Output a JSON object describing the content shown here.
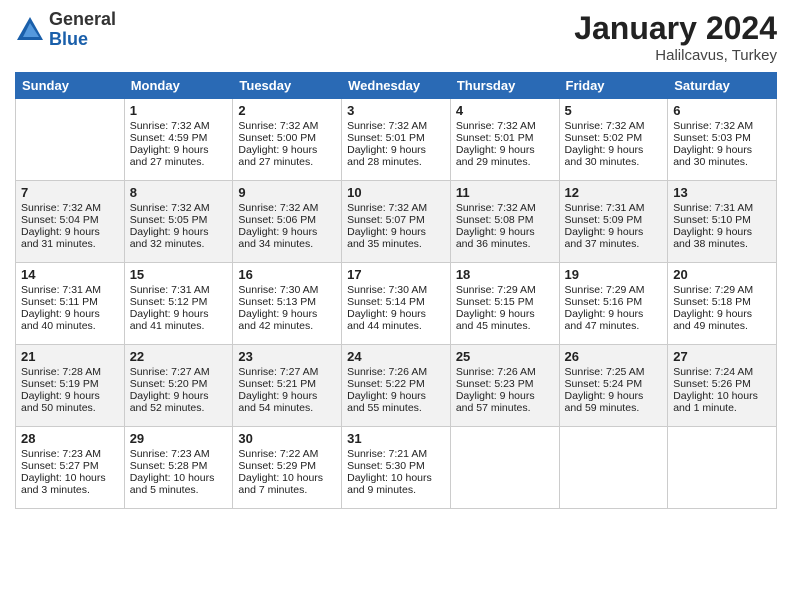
{
  "logo": {
    "general": "General",
    "blue": "Blue"
  },
  "title": {
    "month_year": "January 2024",
    "location": "Halilcavus, Turkey"
  },
  "days_of_week": [
    "Sunday",
    "Monday",
    "Tuesday",
    "Wednesday",
    "Thursday",
    "Friday",
    "Saturday"
  ],
  "weeks": [
    [
      {
        "day": "",
        "sunrise": "",
        "sunset": "",
        "daylight": ""
      },
      {
        "day": "1",
        "sunrise": "Sunrise: 7:32 AM",
        "sunset": "Sunset: 4:59 PM",
        "daylight": "Daylight: 9 hours and 27 minutes."
      },
      {
        "day": "2",
        "sunrise": "Sunrise: 7:32 AM",
        "sunset": "Sunset: 5:00 PM",
        "daylight": "Daylight: 9 hours and 27 minutes."
      },
      {
        "day": "3",
        "sunrise": "Sunrise: 7:32 AM",
        "sunset": "Sunset: 5:01 PM",
        "daylight": "Daylight: 9 hours and 28 minutes."
      },
      {
        "day": "4",
        "sunrise": "Sunrise: 7:32 AM",
        "sunset": "Sunset: 5:01 PM",
        "daylight": "Daylight: 9 hours and 29 minutes."
      },
      {
        "day": "5",
        "sunrise": "Sunrise: 7:32 AM",
        "sunset": "Sunset: 5:02 PM",
        "daylight": "Daylight: 9 hours and 30 minutes."
      },
      {
        "day": "6",
        "sunrise": "Sunrise: 7:32 AM",
        "sunset": "Sunset: 5:03 PM",
        "daylight": "Daylight: 9 hours and 30 minutes."
      }
    ],
    [
      {
        "day": "7",
        "sunrise": "Sunrise: 7:32 AM",
        "sunset": "Sunset: 5:04 PM",
        "daylight": "Daylight: 9 hours and 31 minutes."
      },
      {
        "day": "8",
        "sunrise": "Sunrise: 7:32 AM",
        "sunset": "Sunset: 5:05 PM",
        "daylight": "Daylight: 9 hours and 32 minutes."
      },
      {
        "day": "9",
        "sunrise": "Sunrise: 7:32 AM",
        "sunset": "Sunset: 5:06 PM",
        "daylight": "Daylight: 9 hours and 34 minutes."
      },
      {
        "day": "10",
        "sunrise": "Sunrise: 7:32 AM",
        "sunset": "Sunset: 5:07 PM",
        "daylight": "Daylight: 9 hours and 35 minutes."
      },
      {
        "day": "11",
        "sunrise": "Sunrise: 7:32 AM",
        "sunset": "Sunset: 5:08 PM",
        "daylight": "Daylight: 9 hours and 36 minutes."
      },
      {
        "day": "12",
        "sunrise": "Sunrise: 7:31 AM",
        "sunset": "Sunset: 5:09 PM",
        "daylight": "Daylight: 9 hours and 37 minutes."
      },
      {
        "day": "13",
        "sunrise": "Sunrise: 7:31 AM",
        "sunset": "Sunset: 5:10 PM",
        "daylight": "Daylight: 9 hours and 38 minutes."
      }
    ],
    [
      {
        "day": "14",
        "sunrise": "Sunrise: 7:31 AM",
        "sunset": "Sunset: 5:11 PM",
        "daylight": "Daylight: 9 hours and 40 minutes."
      },
      {
        "day": "15",
        "sunrise": "Sunrise: 7:31 AM",
        "sunset": "Sunset: 5:12 PM",
        "daylight": "Daylight: 9 hours and 41 minutes."
      },
      {
        "day": "16",
        "sunrise": "Sunrise: 7:30 AM",
        "sunset": "Sunset: 5:13 PM",
        "daylight": "Daylight: 9 hours and 42 minutes."
      },
      {
        "day": "17",
        "sunrise": "Sunrise: 7:30 AM",
        "sunset": "Sunset: 5:14 PM",
        "daylight": "Daylight: 9 hours and 44 minutes."
      },
      {
        "day": "18",
        "sunrise": "Sunrise: 7:29 AM",
        "sunset": "Sunset: 5:15 PM",
        "daylight": "Daylight: 9 hours and 45 minutes."
      },
      {
        "day": "19",
        "sunrise": "Sunrise: 7:29 AM",
        "sunset": "Sunset: 5:16 PM",
        "daylight": "Daylight: 9 hours and 47 minutes."
      },
      {
        "day": "20",
        "sunrise": "Sunrise: 7:29 AM",
        "sunset": "Sunset: 5:18 PM",
        "daylight": "Daylight: 9 hours and 49 minutes."
      }
    ],
    [
      {
        "day": "21",
        "sunrise": "Sunrise: 7:28 AM",
        "sunset": "Sunset: 5:19 PM",
        "daylight": "Daylight: 9 hours and 50 minutes."
      },
      {
        "day": "22",
        "sunrise": "Sunrise: 7:27 AM",
        "sunset": "Sunset: 5:20 PM",
        "daylight": "Daylight: 9 hours and 52 minutes."
      },
      {
        "day": "23",
        "sunrise": "Sunrise: 7:27 AM",
        "sunset": "Sunset: 5:21 PM",
        "daylight": "Daylight: 9 hours and 54 minutes."
      },
      {
        "day": "24",
        "sunrise": "Sunrise: 7:26 AM",
        "sunset": "Sunset: 5:22 PM",
        "daylight": "Daylight: 9 hours and 55 minutes."
      },
      {
        "day": "25",
        "sunrise": "Sunrise: 7:26 AM",
        "sunset": "Sunset: 5:23 PM",
        "daylight": "Daylight: 9 hours and 57 minutes."
      },
      {
        "day": "26",
        "sunrise": "Sunrise: 7:25 AM",
        "sunset": "Sunset: 5:24 PM",
        "daylight": "Daylight: 9 hours and 59 minutes."
      },
      {
        "day": "27",
        "sunrise": "Sunrise: 7:24 AM",
        "sunset": "Sunset: 5:26 PM",
        "daylight": "Daylight: 10 hours and 1 minute."
      }
    ],
    [
      {
        "day": "28",
        "sunrise": "Sunrise: 7:23 AM",
        "sunset": "Sunset: 5:27 PM",
        "daylight": "Daylight: 10 hours and 3 minutes."
      },
      {
        "day": "29",
        "sunrise": "Sunrise: 7:23 AM",
        "sunset": "Sunset: 5:28 PM",
        "daylight": "Daylight: 10 hours and 5 minutes."
      },
      {
        "day": "30",
        "sunrise": "Sunrise: 7:22 AM",
        "sunset": "Sunset: 5:29 PM",
        "daylight": "Daylight: 10 hours and 7 minutes."
      },
      {
        "day": "31",
        "sunrise": "Sunrise: 7:21 AM",
        "sunset": "Sunset: 5:30 PM",
        "daylight": "Daylight: 10 hours and 9 minutes."
      },
      {
        "day": "",
        "sunrise": "",
        "sunset": "",
        "daylight": ""
      },
      {
        "day": "",
        "sunrise": "",
        "sunset": "",
        "daylight": ""
      },
      {
        "day": "",
        "sunrise": "",
        "sunset": "",
        "daylight": ""
      }
    ]
  ]
}
